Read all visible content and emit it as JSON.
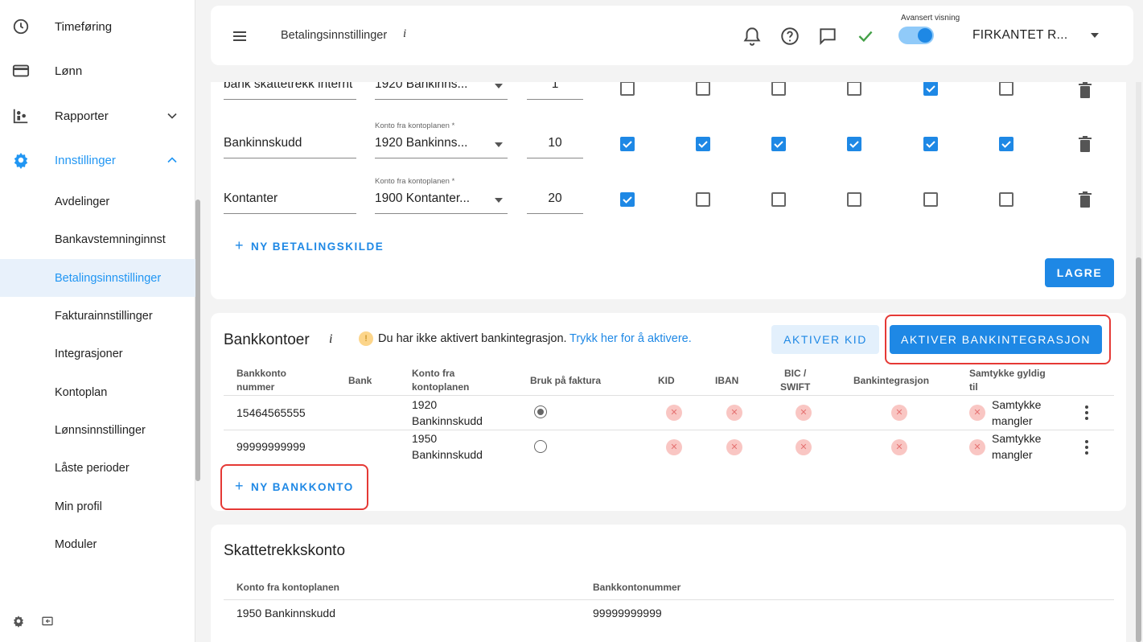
{
  "sidebar": {
    "items": [
      {
        "label": "Timeføring",
        "icon": "clock-icon"
      },
      {
        "label": "Lønn",
        "icon": "credit-card-icon"
      },
      {
        "label": "Rapporter",
        "icon": "reports-icon"
      },
      {
        "label": "Innstillinger",
        "icon": "gear-icon"
      }
    ],
    "sub_items": [
      "Avdelinger",
      "Bankavstemninginnst",
      "Betalingsinnstillinger",
      "Fakturainnstillinger",
      "Integrasjoner",
      "Kontoplan",
      "Lønnsinnstillinger",
      "Låste perioder",
      "Min profil",
      "Moduler"
    ],
    "selected_sub_item": "Betalingsinnstillinger",
    "accent_color": "#2196f3"
  },
  "header": {
    "page_title": "Betalingsinnstillinger",
    "info": "i",
    "advanced_view_label": "Avansert visning",
    "advanced_view_on": true,
    "company": "FIRKANTET R..."
  },
  "payment_sources": {
    "konto_label": "Konto fra kontoplanen *",
    "rows": [
      {
        "name": "bank skattetrekk internt",
        "konto": "1920 Bankinns...",
        "number": "1",
        "checks": [
          false,
          false,
          false,
          false,
          true,
          false
        ]
      },
      {
        "name": "Bankinnskudd",
        "konto": "1920 Bankinns...",
        "number": "10",
        "checks": [
          true,
          true,
          true,
          true,
          true,
          true
        ]
      },
      {
        "name": "Kontanter",
        "konto": "1900 Kontanter...",
        "number": "20",
        "checks": [
          true,
          false,
          false,
          false,
          false,
          false
        ]
      }
    ],
    "new_button": "NY BETALINGSKILDE",
    "save_button": "LAGRE"
  },
  "bank_accounts": {
    "title": "Bankkontoer",
    "info": "i",
    "warning_icon": "!",
    "warning_text": "Du har ikke aktivert bankintegrasjon.",
    "warning_link": "Trykk her for å aktivere.",
    "kid_button": "AKTIVER KID",
    "integration_button": "AKTIVER BANKINTEGRASJON",
    "columns": {
      "number_1": "Bankkonto",
      "number_2": "nummer",
      "bank": "Bank",
      "konto_1": "Konto fra",
      "konto_2": "kontoplanen",
      "invoice": "Bruk på faktura",
      "kid": "KID",
      "iban": "IBAN",
      "bic_1": "BIC /",
      "bic_2": "SWIFT",
      "integration": "Bankintegrasjon",
      "consent_1": "Samtykke gyldig",
      "consent_2": "til"
    },
    "rows": [
      {
        "number": "15464565555",
        "konto_1": "1920",
        "konto_2": "Bankinnskudd",
        "invoice": true,
        "consent_1": "Samtykke",
        "consent_2": "mangler"
      },
      {
        "number": "99999999999",
        "konto_1": "1950",
        "konto_2": "Bankinnskudd",
        "invoice": false,
        "consent_1": "Samtykke",
        "consent_2": "mangler"
      }
    ],
    "status_x": "✕",
    "new_button": "NY BANKKONTO"
  },
  "tax_account": {
    "title": "Skattetrekkskonto",
    "col_konto": "Konto fra kontoplanen",
    "col_number": "Bankkontonummer",
    "konto": "1950 Bankinnskudd",
    "number": "99999999999"
  }
}
